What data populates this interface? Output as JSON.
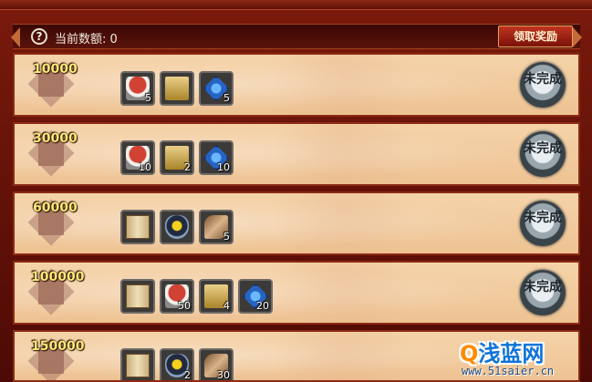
{
  "header": {
    "current_amount_label": "当前数额: 0",
    "help_icon": "?",
    "claim_button": "领取奖励"
  },
  "rows": [
    {
      "tier": "10000",
      "status": "未完成",
      "items": [
        {
          "icon": "gift-pack-icon",
          "count": "5"
        },
        {
          "icon": "treasure-chest-icon",
          "count": ""
        },
        {
          "icon": "blue-crystal-icon",
          "count": "5"
        }
      ]
    },
    {
      "tier": "30000",
      "status": "未完成",
      "items": [
        {
          "icon": "gift-pack-icon",
          "count": "10"
        },
        {
          "icon": "treasure-chest-icon",
          "count": "2"
        },
        {
          "icon": "blue-crystal-icon",
          "count": "10"
        }
      ]
    },
    {
      "tier": "60000",
      "status": "未完成",
      "items": [
        {
          "icon": "scroll-icon",
          "count": ""
        },
        {
          "icon": "shield-alert-icon",
          "count": ""
        },
        {
          "icon": "feather-icon",
          "count": "5"
        }
      ]
    },
    {
      "tier": "100000",
      "status": "未完成",
      "items": [
        {
          "icon": "scroll-icon",
          "count": ""
        },
        {
          "icon": "gift-pack-icon",
          "count": "50"
        },
        {
          "icon": "treasure-chest-icon",
          "count": "4"
        },
        {
          "icon": "blue-crystal-icon",
          "count": "20"
        }
      ]
    },
    {
      "tier": "150000",
      "status": "",
      "items": [
        {
          "icon": "scroll-icon",
          "count": ""
        },
        {
          "icon": "shield-alert-icon",
          "count": "2"
        },
        {
          "icon": "feather-icon",
          "count": "30"
        }
      ]
    }
  ],
  "watermark": {
    "logo_lead": "Q",
    "logo_text": "浅蓝网",
    "url": "www.51saier.cn"
  }
}
